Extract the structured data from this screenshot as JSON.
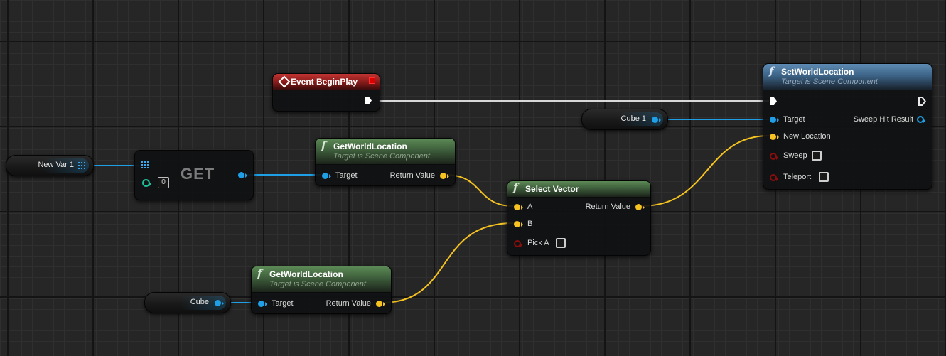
{
  "graph": {
    "nodes": {
      "event_begin_play": {
        "title": "Event BeginPlay"
      },
      "set_world_location": {
        "title": "SetWorldLocation",
        "subtitle": "Target is Scene Component",
        "pins": {
          "target": "Target",
          "sweep_hit_result": "Sweep Hit Result",
          "new_location": "New Location",
          "sweep": "Sweep",
          "teleport": "Teleport"
        }
      },
      "get_world_location_1": {
        "title": "GetWorldLocation",
        "subtitle": "Target is Scene Component",
        "pins": {
          "target": "Target",
          "return_value": "Return Value"
        }
      },
      "get_world_location_2": {
        "title": "GetWorldLocation",
        "subtitle": "Target is Scene Component",
        "pins": {
          "target": "Target",
          "return_value": "Return Value"
        }
      },
      "select_vector": {
        "title": "Select Vector",
        "pins": {
          "a": "A",
          "b": "B",
          "pick_a": "Pick A",
          "return_value": "Return Value"
        }
      },
      "array_get": {
        "label": "GET",
        "index": "0"
      }
    },
    "variables": {
      "new_var_1": "New Var 1",
      "cube_1": "Cube 1",
      "cube": "Cube"
    },
    "colors": {
      "object_pin": "#1f9fe6",
      "vector_pin": "#f6c320",
      "bool_pin": "#8a0d0d",
      "exec_wire": "#d8d8d8",
      "function_header": "#5c8a56",
      "target_function_header": "#5e8bb3",
      "event_header": "#c03432"
    }
  }
}
